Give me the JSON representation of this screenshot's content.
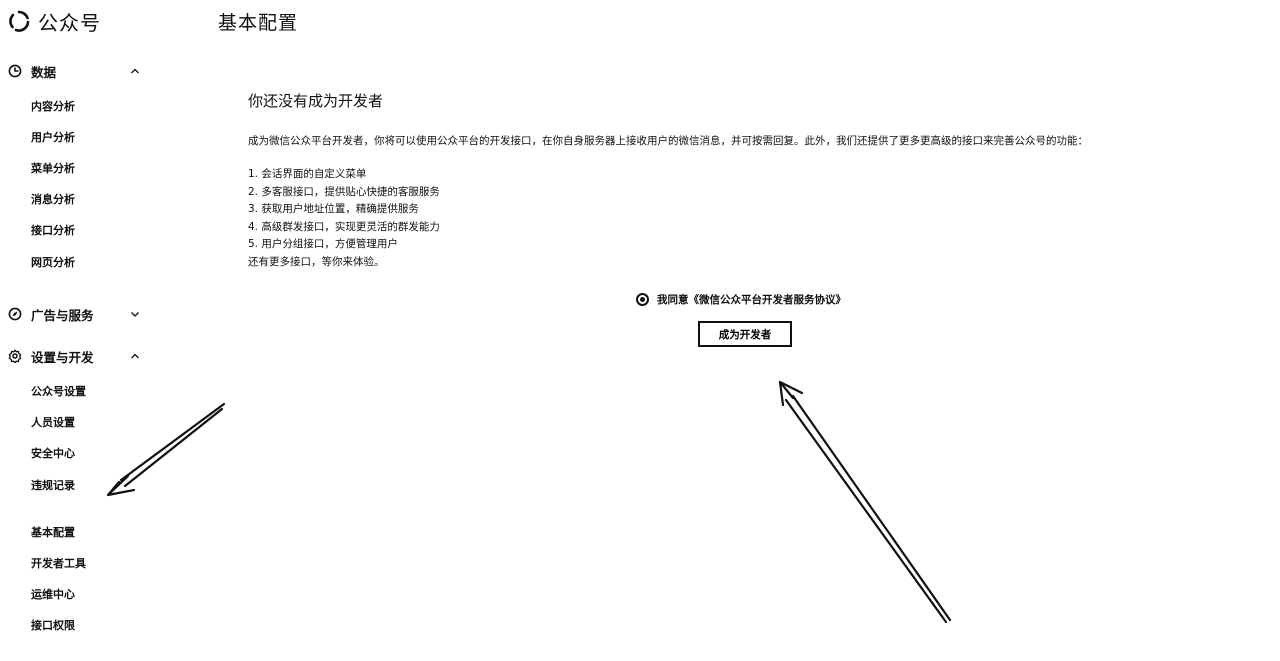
{
  "brand": {
    "name": "公众号"
  },
  "header": {
    "title": "基本配置"
  },
  "sidebar": {
    "groups": [
      {
        "label": "数据",
        "icon": "pie-chart-icon",
        "expanded": true,
        "items": [
          "内容分析",
          "用户分析",
          "菜单分析",
          "消息分析",
          "接口分析",
          "网页分析"
        ]
      },
      {
        "label": "广告与服务",
        "icon": "compass-icon",
        "expanded": false,
        "items": []
      },
      {
        "label": "设置与开发",
        "icon": "gear-icon",
        "expanded": true,
        "items": [
          "公众号设置",
          "人员设置",
          "安全中心",
          "违规记录",
          "基本配置",
          "开发者工具",
          "运维中心",
          "接口权限"
        ]
      }
    ]
  },
  "main": {
    "heading": "你还没有成为开发者",
    "intro": "成为微信公众平台开发者，你将可以使用公众平台的开发接口，在你自身服务器上接收用户的微信消息，并可按需回复。此外，我们还提供了更多更高级的接口来完善公众号的功能：",
    "features": [
      "1. 会话界面的自定义菜单",
      "2. 多客服接口，提供贴心快捷的客服服务",
      "3. 获取用户地址位置，精确提供服务",
      "4. 高级群发接口，实现更灵活的群发能力",
      "5. 用户分组接口，方便管理用户",
      "还有更多接口，等你来体验。"
    ],
    "agree_text": "我同意《微信公众平台开发者服务协议》",
    "agree_checked": true,
    "button_label": "成为开发者"
  }
}
